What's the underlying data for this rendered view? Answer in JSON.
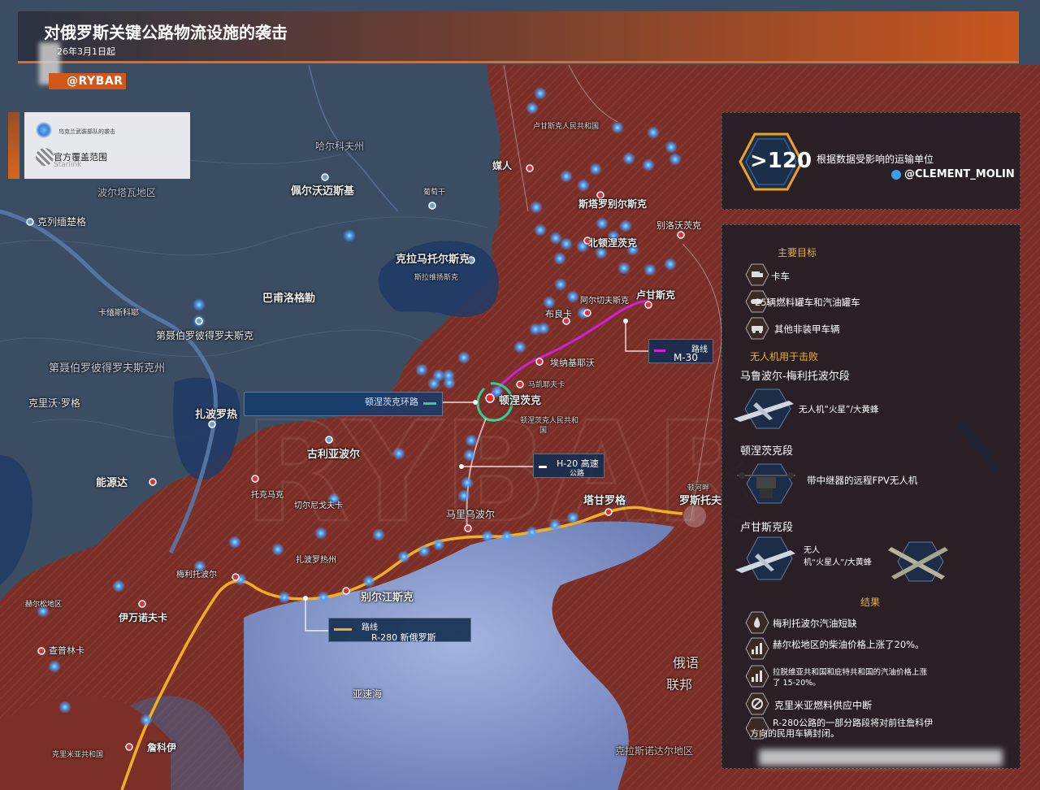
{
  "header": {
    "title": "对俄罗斯关键公路物流设施的袭击",
    "subtitle": "26年3月1日起",
    "brand": "@RYBAR"
  },
  "legend": {
    "item1": "乌克兰武装部队的袭击",
    "item2": "官方覆盖范围",
    "item3": "Starlink"
  },
  "stats": {
    "count": ">120",
    "description": "根据数据受影响的运输单位",
    "handle": "@CLEMENT_MOLIN"
  },
  "info": {
    "main_targets_title": "主要目标",
    "targets": [
      "卡车",
      "25辆燃料罐车和汽油罐车",
      "其他非装甲车辆"
    ],
    "drones_title": "无人机用于击败",
    "sector1_title": "马鲁波尔-梅利托波尔段",
    "sector1_drone": "无人机“火星”/大黄蜂",
    "sector2_title": "顿涅茨克段",
    "sector2_drone": "带中继器的远程FPV无人机",
    "sector3_title": "卢甘斯克段",
    "sector3_drone_a": "无人",
    "sector3_drone_b": "机“火星人”/大黄蜂",
    "results_title": "结果",
    "results": [
      "梅利托波尔汽油短缺",
      "赫尔松地区的柴油价格上涨了20%。",
      "拉脱维亚共和国和庇特共和国的汽油价格上涨",
      "了 15-20%。",
      "克里米亚燃料供应中断",
      "R-280公路的一部分路段将对前往詹科伊",
      "方向的民用车辆封闭。"
    ]
  },
  "routes": {
    "m30_label": "路线",
    "m30_name": "M-30",
    "ring_label": "顿涅茨克环路",
    "h20_label": "H-20 高速",
    "h20_sub": "公路",
    "r280_label": "路线",
    "r280_name": "R-280 新俄罗斯"
  },
  "places": {
    "kharkiv": "哈尔科夫州",
    "poltava": "波尔塔瓦地区",
    "kremenchuk": "克列缅楚格",
    "kremenchug2": "卡缅斯科耶",
    "dnipro_city": "第聂伯罗彼得罗夫斯克",
    "dnipro_oblast": "第聂伯罗彼得罗夫斯克州",
    "kryvyi": "克里沃·罗格",
    "pavlohrad": "巴甫洛格勒",
    "pervomaisk": "佩尔沃迈斯基",
    "izium": "葡萄干",
    "kramatorsk": "克拉马托尔斯克",
    "sloviansk": "斯拉维扬斯克",
    "zaporizhzhia": "扎波罗热",
    "hulyaipole": "古利亚波尔",
    "energodar": "能源达",
    "tokmak": "托克马克",
    "chernihivka": "切尔尼戈夫卡",
    "zaporizhzhia_oblast": "扎波罗热州",
    "melitopol": "梅利托波尔",
    "berdyansk": "别尔江斯克",
    "mariupol": "马里乌波尔",
    "kherson_region": "赫尔松地区",
    "ivanovka": "伊万诺夫卡",
    "chaplinka": "查普林卡",
    "dzhankoi": "詹科伊",
    "crimea": "克里米亚共和国",
    "azov": "亚速海",
    "russia_a": "俄语",
    "russia_b": "联邦",
    "krasnodar": "克拉斯诺达尔地区",
    "rostov_a": "顿河畔",
    "rostov_b": "罗斯托夫",
    "taganrog": "塔甘罗格",
    "donetsk": "顿涅茨克",
    "dpr_a": "顿涅茨克人民共和",
    "dpr_b": "国",
    "makeevka": "马凯耶夫卡",
    "yenakiieve": "埃纳基耶沃",
    "horlivka": "布良卡",
    "alchevsk": "阿尔切夫斯克",
    "luhansk": "卢甘斯克",
    "lpr": "卢甘斯克人民共和国",
    "severodonetsk": "北顿涅茨克",
    "starobilsk": "斯塔罗别尔斯克",
    "belovodsk": "别洛沃茨克",
    "svatove": "媒人"
  },
  "colors": {
    "accent": "#e06a26",
    "russia_land": "#7a2e26",
    "ukraine_land": "#3a4c60",
    "sea": "#7d8fc4",
    "route_m30": "#d020d8",
    "route_r280": "#f0b020",
    "route_ring": "#30d090",
    "strike": "#4aa0ff"
  }
}
